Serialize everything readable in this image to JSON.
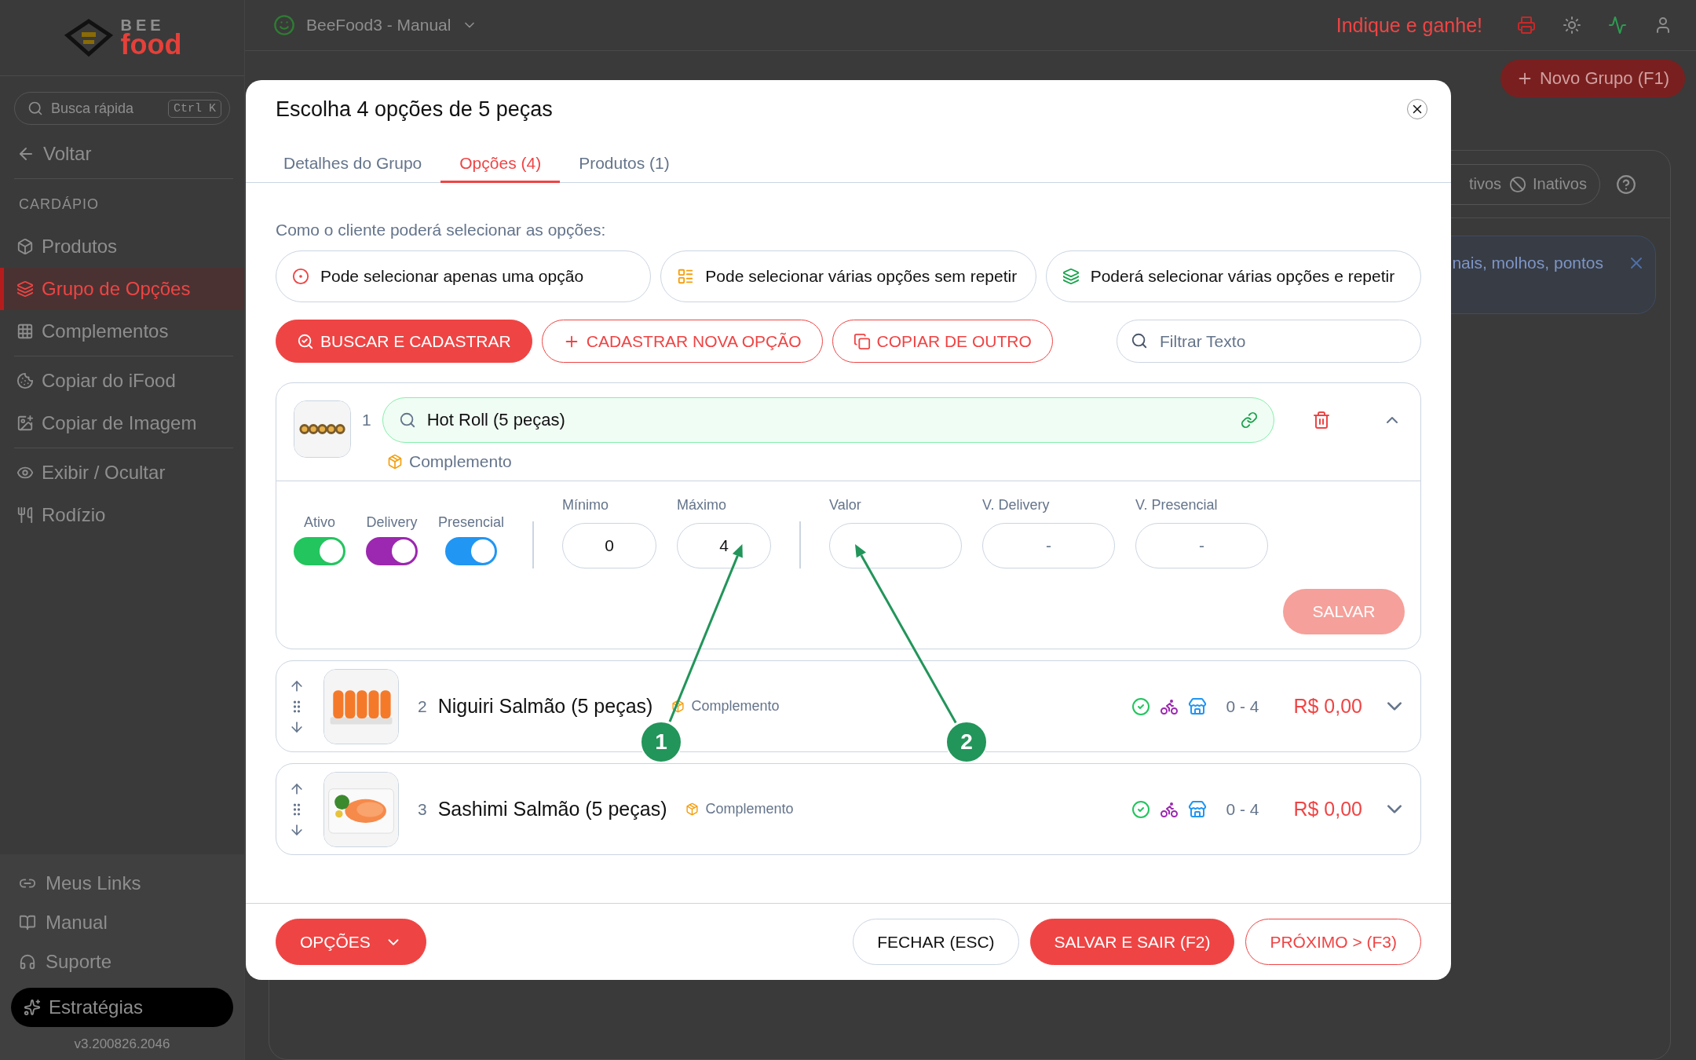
{
  "app": {
    "logo_top": "BEE",
    "logo_bottom": "food",
    "workspace": "BeeFood3 - Manual",
    "referral": "Indique e ganhe!"
  },
  "sidebar": {
    "search_placeholder": "Busca rápida",
    "shortcut": "Ctrl K",
    "back": "Voltar",
    "section": "CARDÁPIO",
    "groups": [
      [
        {
          "label": "Produtos",
          "selected": false
        },
        {
          "label": "Grupo de Opções",
          "selected": true
        },
        {
          "label": "Complementos",
          "selected": false
        }
      ],
      [
        {
          "label": "Copiar do iFood",
          "selected": false
        },
        {
          "label": "Copiar de Imagem",
          "selected": false
        }
      ],
      [
        {
          "label": "Exibir / Ocultar",
          "selected": false
        },
        {
          "label": "Rodízio",
          "selected": false
        }
      ]
    ],
    "footer_items": [
      "Meus Links",
      "Manual",
      "Suporte"
    ],
    "cta": "Estratégias",
    "version": "v3.200826.2046"
  },
  "subnav": {
    "new_button": "Novo Grupo (F1)"
  },
  "content": {
    "filters": [
      "tivos",
      "Inativos"
    ],
    "notice": "nais, molhos, pontos"
  },
  "modal": {
    "title": "Escolha 4 opções de 5 peças",
    "tabs": [
      {
        "label": "Detalhes do Grupo",
        "selected": false
      },
      {
        "label": "Opções (4)",
        "selected": true
      },
      {
        "label": "Produtos (1)",
        "selected": false
      }
    ],
    "prompt": "Como o cliente poderá selecionar as opções:",
    "modes": [
      "Pode selecionar apenas uma opção",
      "Pode selecionar várias opções sem repetir",
      "Poderá selecionar várias opções e repetir"
    ],
    "actions": [
      {
        "label": "BUSCAR E CADASTRAR",
        "kind": "primary"
      },
      {
        "label": "CADASTRAR NOVA OPÇÃO",
        "kind": "outline"
      },
      {
        "label": "COPIAR DE OUTRO",
        "kind": "outline"
      }
    ],
    "filter_placeholder": "Filtrar Texto",
    "options": [
      {
        "number": "1",
        "name": "Hot Roll (5 peças)",
        "type": "Complemento",
        "expanded": true,
        "toggles": [
          {
            "label": "Ativo",
            "on": true,
            "color": "#22c55e"
          },
          {
            "label": "Delivery",
            "on": true,
            "color": "#9c27b0"
          },
          {
            "label": "Presencial",
            "on": true,
            "color": "#2196f3"
          }
        ],
        "limits": [
          {
            "label": "Mínimo",
            "value": "0"
          },
          {
            "label": "Máximo",
            "value": "4"
          }
        ],
        "prices": [
          {
            "label": "Valor"
          },
          {
            "label": "V. Delivery",
            "placeholder": "-"
          },
          {
            "label": "V. Presencial",
            "placeholder": "-"
          }
        ],
        "save": {
          "label": "SALVAR",
          "disabled": true
        }
      },
      {
        "number": "2",
        "name": "Niguiri Salmão (5 peças)",
        "type": "Complemento",
        "expanded": false,
        "range": "0 - 4",
        "price": "R$ 0,00"
      },
      {
        "number": "3",
        "name": "Sashimi Salmão (5 peças)",
        "type": "Complemento",
        "expanded": false,
        "range": "0 - 4",
        "price": "R$ 0,00"
      }
    ],
    "footer": {
      "menu": "OPÇÕES",
      "buttons": [
        {
          "label": "FECHAR (ESC)",
          "kind": "plain"
        },
        {
          "label": "SALVAR E SAIR (F2)",
          "kind": "primary"
        },
        {
          "label": "PRÓXIMO > (F3)",
          "kind": "outline"
        }
      ]
    }
  },
  "annotations": [
    {
      "label": "1"
    },
    {
      "label": "2"
    }
  ]
}
